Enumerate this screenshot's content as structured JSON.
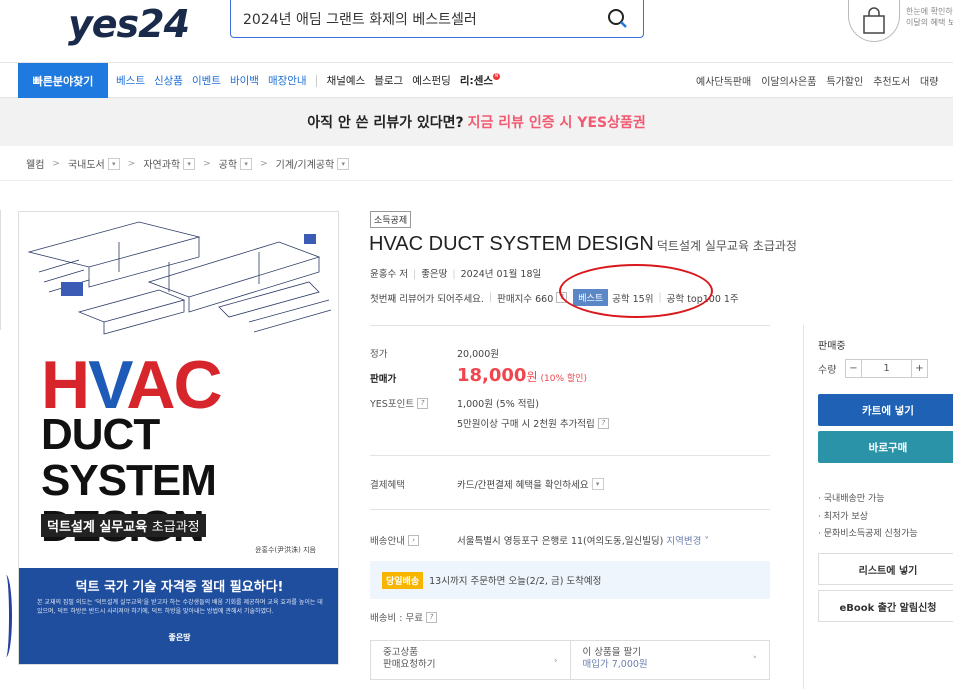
{
  "header": {
    "logo": "yes24",
    "search_value": "2024년 애딤 그랜트 화제의 베스트셀러",
    "bag_text": [
      "한눈에 확인하",
      "이달의 혜택 보"
    ]
  },
  "nav": {
    "quick_find": "빠른분야찾기",
    "left_items": [
      "베스트",
      "신상품",
      "이벤트",
      "바이백",
      "매장안내"
    ],
    "left_items_dark": [
      "채널예스",
      "블로그",
      "예스펀딩",
      "리:센스"
    ],
    "new_mark": "N",
    "right_items": [
      "예사단독판매",
      "이달의사은품",
      "특가할인",
      "추천도서",
      "대량"
    ]
  },
  "banner": {
    "text": "아직 안 쓴 리뷰가 있다면?",
    "highlight": "지금 리뷰 인증 시 YES상품권"
  },
  "breadcrumb": [
    "웰컴",
    "국내도서",
    "자연과학",
    "공학",
    "기계/기계공학"
  ],
  "cover": {
    "h": "H",
    "v": "V",
    "ac": "AC",
    "line2": "DUCT SYSTEM",
    "line3": "DESIGN",
    "subtitle_bold": "덕트설계 실무교육",
    "subtitle_light": "초급과정",
    "author": "윤홍수(尹洪洙) 지음",
    "headline": "덕트 국가 기술 자격증 절대 필요하다!",
    "blurb": "본 교재의 집필 의도는 '덕트설계 실무교육'을 받고자 하는 수강생들의 배움 기회를 제공하며 교육 효과를 높이는 데 있으며, 덕트 하방은 반드시 사리져야 하기에, 덕트 하방을 맞아내는 방법에 관해서 기술하였다.",
    "publisher": "좋은땅"
  },
  "product": {
    "tag": "소득공제",
    "title": "HVAC DUCT SYSTEM DESIGN",
    "subtitle": "덕트설계 실무교육 초급과정",
    "author": "윤홍수 저",
    "publisher": "좋은땅",
    "date": "2024년 01월 18일",
    "review": "첫번째 리뷰어가 되어주세요.",
    "sales_index": "판매지수 660",
    "best_badge": "베스트",
    "rank1": "공학 15위",
    "rank2": "공학 top100 1주",
    "q": "?"
  },
  "pricing": {
    "list_label": "정가",
    "list_price": "20,000원",
    "sale_label": "판매가",
    "sale_price": "18,000",
    "won": "원",
    "discount": "(10% 할인)",
    "point_label": "YES포인트",
    "point_value": "1,000원 (5% 적립)",
    "point_extra": "5만원이상 구매 시 2천원 추가적립",
    "benefit_label": "결제혜택",
    "benefit_value": "카드/간편결제 혜택을 확인하세요",
    "delivery_label": "배송안내",
    "delivery_addr": "서울특별시 영등포구 은행로 11(여의도동,일신빌딩)",
    "delivery_change": "지역변경",
    "today_badge": "당일배송",
    "today_text": "13시까지 주문하면 오늘(2/2, 금) 도착예정",
    "ship_fee": "배송비 : 무료",
    "used_title": "중고상품",
    "used_sub": "판매요청하기",
    "sell_title": "이 상품을 팔기",
    "sell_sub": "매입가 7,000원"
  },
  "side": {
    "status": "판매중",
    "qty_label": "수량",
    "qty": "1",
    "minus": "−",
    "plus": "+",
    "cart": "카트에 넣기",
    "buy": "바로구매",
    "bullets": [
      "· 국내배송만 가능",
      "· 최저가 보상",
      "· 문화비소득공제 신청가능"
    ],
    "list_btn": "리스트에 넣기",
    "ebook_btn": "eBook 출간 알림신청"
  },
  "colors": {
    "accent": "#1f7ae0",
    "price": "#f0464f",
    "cart": "#1f62b5",
    "buy": "#2a93a8",
    "highlight": "#f25a72"
  }
}
